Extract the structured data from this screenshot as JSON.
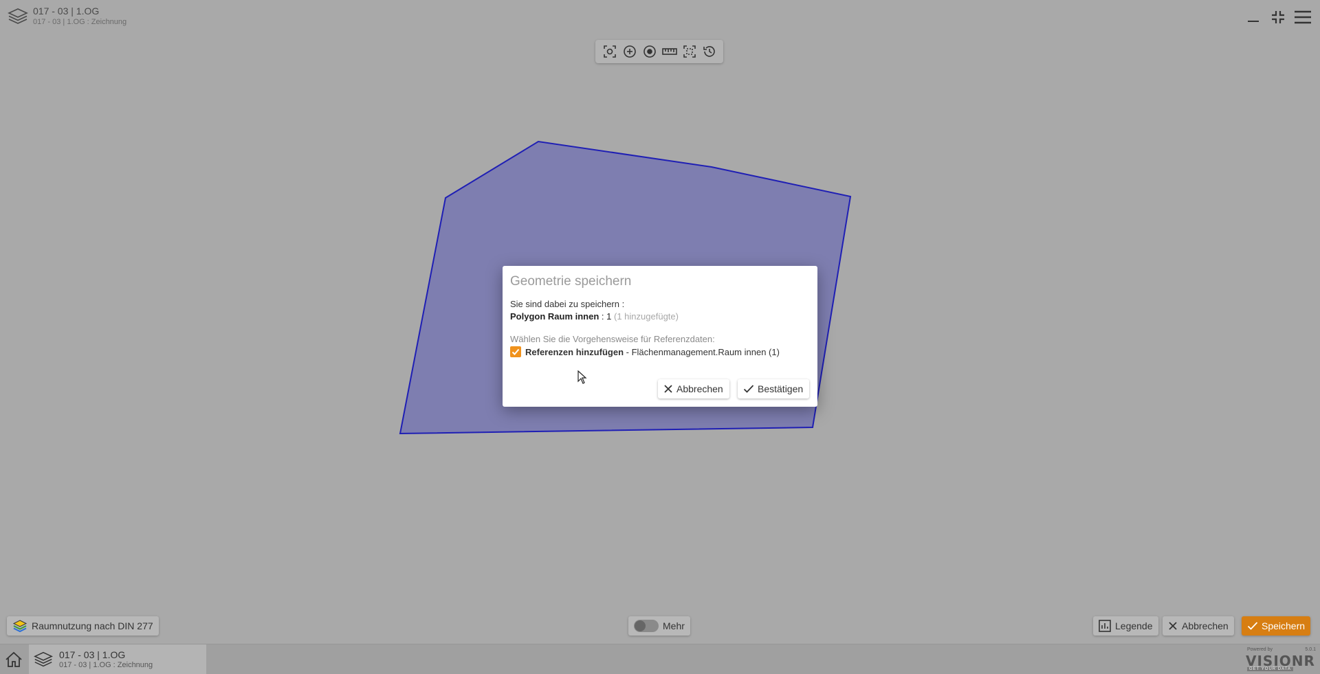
{
  "header": {
    "title": "017 - 03 | 1.OG",
    "subtitle": "017 - 03 | 1.OG : Zeichnung",
    "icons": [
      "layers-icon",
      "minimize-icon",
      "exit-fullscreen-icon",
      "menu-icon"
    ]
  },
  "toolbar": {
    "tools": [
      "screenshot-icon",
      "zoom-in-icon",
      "locate-icon",
      "measure-icon",
      "select-area-icon",
      "history-icon"
    ]
  },
  "dialog": {
    "title": "Geometrie speichern",
    "line1": "Sie sind dabei zu speichern :",
    "item_name": "Polygon Raum innen",
    "item_count": ": 1",
    "item_note": "(1 hinzugefügte)",
    "reference_prompt": "Wählen Sie die Vorgehensweise für Referenzdaten:",
    "checkbox_checked": true,
    "checkbox_label": "Referenzen hinzufügen",
    "checkbox_detail": "- Flächenmanagement.Raum innen (1)",
    "cancel_label": "Abbrechen",
    "confirm_label": "Bestätigen"
  },
  "bottom": {
    "layer_button": "Raumnutzung nach DIN 277",
    "more_toggle": "Mehr",
    "legend_button": "Legende",
    "cancel_button": "Abbrechen",
    "save_button": "Speichern"
  },
  "statusbar": {
    "tab_title": "017 - 03 | 1.OG",
    "tab_subtitle": "017 - 03 | 1.OG : Zeichnung",
    "powered_by": "Powered by",
    "version": "5.0.1",
    "brand": "VISIONR",
    "brand_tag": "GET YOUR DATA"
  },
  "colors": {
    "accent": "#f0921c",
    "save": "#d77e12",
    "polygon_fill": "#7c7cb0",
    "polygon_stroke": "#1f1fb4"
  }
}
